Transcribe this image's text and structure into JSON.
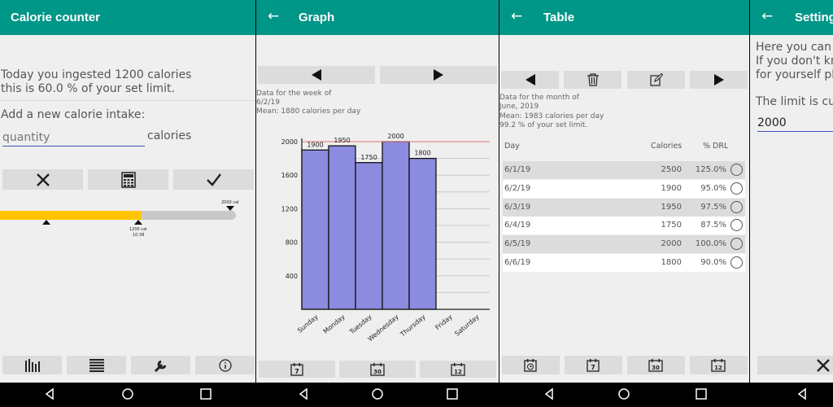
{
  "screen1": {
    "title": "Calorie counter",
    "summary_line1": "Today you ingested 1200 calories",
    "summary_line2": "this is 60.0 % of your set limit.",
    "add_prompt": "Add a new calorie intake:",
    "quantity_placeholder": "quantity",
    "quantity_unit": "calories",
    "progress": {
      "consumed_fraction": 0.6,
      "limit_label": "2000 cal",
      "current_label": "1200 cal",
      "current_time": "10:38"
    },
    "bottom_icons": [
      "graph-icon",
      "table-icon",
      "settings-icon",
      "info-icon"
    ]
  },
  "screen2": {
    "title": "Graph",
    "week_line1": "Data for the week of",
    "week_line2": "6/2/19",
    "week_line3": "Mean: 1880 calories per day",
    "bottom_labels": [
      "7",
      "30",
      "12"
    ]
  },
  "chart_data": {
    "type": "bar",
    "categories": [
      "Sunday",
      "Monday",
      "Tuesday",
      "Wednesday",
      "Thursday",
      "Friday",
      "Saturday"
    ],
    "values": [
      1900,
      1950,
      1750,
      2000,
      1800,
      null,
      null
    ],
    "data_labels": [
      "1900",
      "1950",
      "1750",
      "2000",
      "1800",
      "",
      ""
    ],
    "limit_line": 2000,
    "ylim": [
      0,
      2000
    ],
    "yticks": [
      400,
      800,
      1200,
      1600,
      2000
    ],
    "bar_color": "#8b8bdf",
    "limit_color": "#e57373",
    "grid": true
  },
  "screen3": {
    "title": "Table",
    "month_line1": "Data for the month of",
    "month_line2": "June, 2019",
    "month_line3": "Mean: 1983 calories per day",
    "month_line4": "99.2 % of your set limit.",
    "headers": {
      "day": "Day",
      "calories": "Calories",
      "drl": "% DRL"
    },
    "rows": [
      {
        "day": "6/1/19",
        "calories": "2500",
        "drl": "125.0%"
      },
      {
        "day": "6/2/19",
        "calories": "1900",
        "drl": "95.0%"
      },
      {
        "day": "6/3/19",
        "calories": "1950",
        "drl": "97.5%"
      },
      {
        "day": "6/4/19",
        "calories": "1750",
        "drl": "87.5%"
      },
      {
        "day": "6/5/19",
        "calories": "2000",
        "drl": "100.0%"
      },
      {
        "day": "6/6/19",
        "calories": "1800",
        "drl": "90.0%"
      }
    ],
    "bottom_labels": [
      "7",
      "30",
      "12"
    ]
  },
  "screen4": {
    "title": "Setting",
    "line1": "Here you can c",
    "line2": "If you don't kno",
    "line3": "for yourself ple",
    "line4": "The limit is cur",
    "limit_value": "2000"
  },
  "colors": {
    "accent": "#009688",
    "progress_fill": "#ffc400",
    "progress_track": "#c8c8c8",
    "stripe": "#dcdcdc"
  }
}
